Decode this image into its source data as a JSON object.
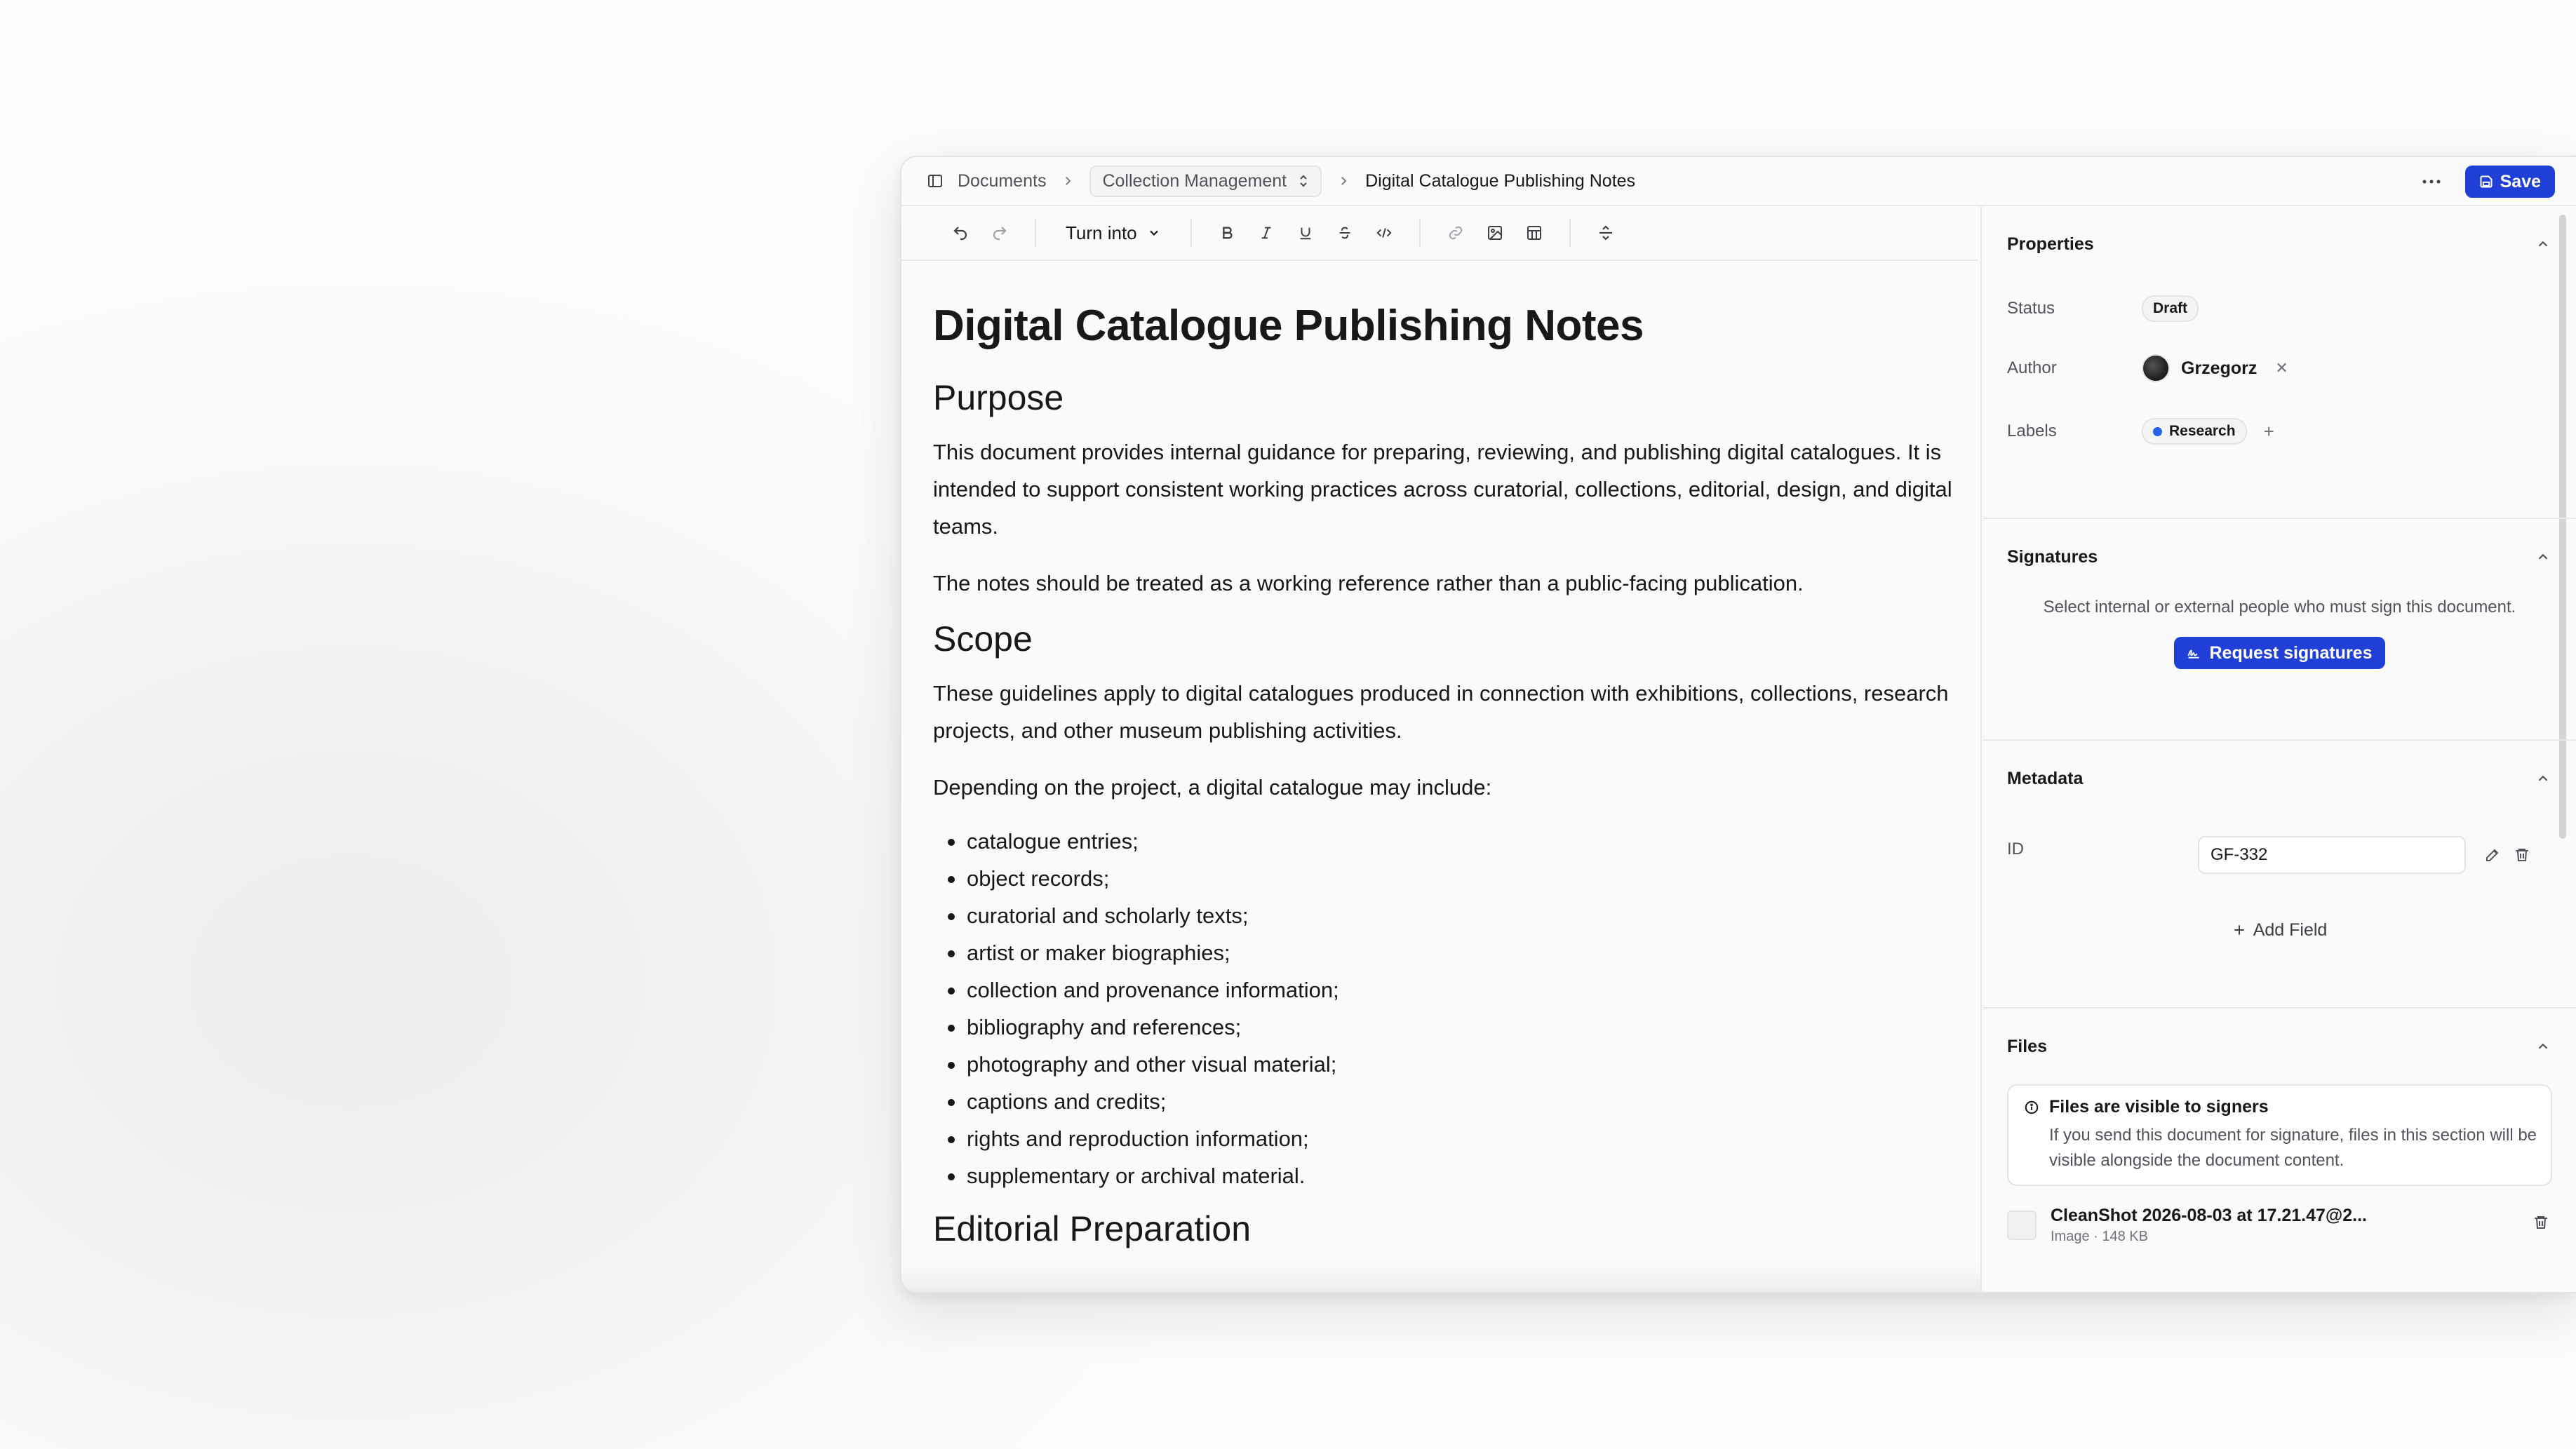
{
  "breadcrumb": {
    "root": "Documents",
    "collection": "Collection Management",
    "current": "Digital Catalogue Publishing Notes"
  },
  "topbar": {
    "save_label": "Save",
    "more_icon": "ellipsis-icon"
  },
  "toolbar": {
    "turn_into_label": "Turn into"
  },
  "document": {
    "title": "Digital Catalogue Publishing Notes",
    "sections": [
      {
        "heading": "Purpose",
        "paragraphs": [
          "This document provides internal guidance for preparing, reviewing, and publishing digital catalogues. It is intended to support consistent working practices across curatorial, collections, editorial, design, and digital teams.",
          "The notes should be treated as a working reference rather than a public-facing publication."
        ]
      },
      {
        "heading": "Scope",
        "paragraphs": [
          "These guidelines apply to digital catalogues produced in connection with exhibitions, collections, research projects, and other museum publishing activities.",
          "Depending on the project, a digital catalogue may include:"
        ],
        "list": [
          "catalogue entries;",
          "object records;",
          "curatorial and scholarly texts;",
          "artist or maker biographies;",
          "collection and provenance information;",
          "bibliography and references;",
          "photography and other visual material;",
          "captions and credits;",
          "rights and reproduction information;",
          "supplementary or archival material."
        ]
      },
      {
        "heading": "Editorial Preparation"
      }
    ]
  },
  "properties": {
    "title": "Properties",
    "status_label": "Status",
    "status_value": "Draft",
    "author_label": "Author",
    "author_name": "Grzegorz",
    "labels_label": "Labels",
    "label_value": "Research",
    "label_color": "#2563eb"
  },
  "signatures": {
    "title": "Signatures",
    "description": "Select internal or external people who must sign this document.",
    "button_label": "Request signatures"
  },
  "metadata": {
    "title": "Metadata",
    "field_label": "ID",
    "field_value": "GF-332",
    "add_field_label": "Add Field"
  },
  "files": {
    "title": "Files",
    "notice_title": "Files are visible to signers",
    "notice_body": "If you send this document for signature, files in this section will be visible alongside the document content.",
    "file_name": "CleanShot 2026-08-03 at 17.21.47@2...",
    "file_meta": "Image · 148 KB"
  },
  "colors": {
    "accent": "#1f3fd6",
    "border": "#e4e4e7",
    "background": "#fafafa"
  }
}
